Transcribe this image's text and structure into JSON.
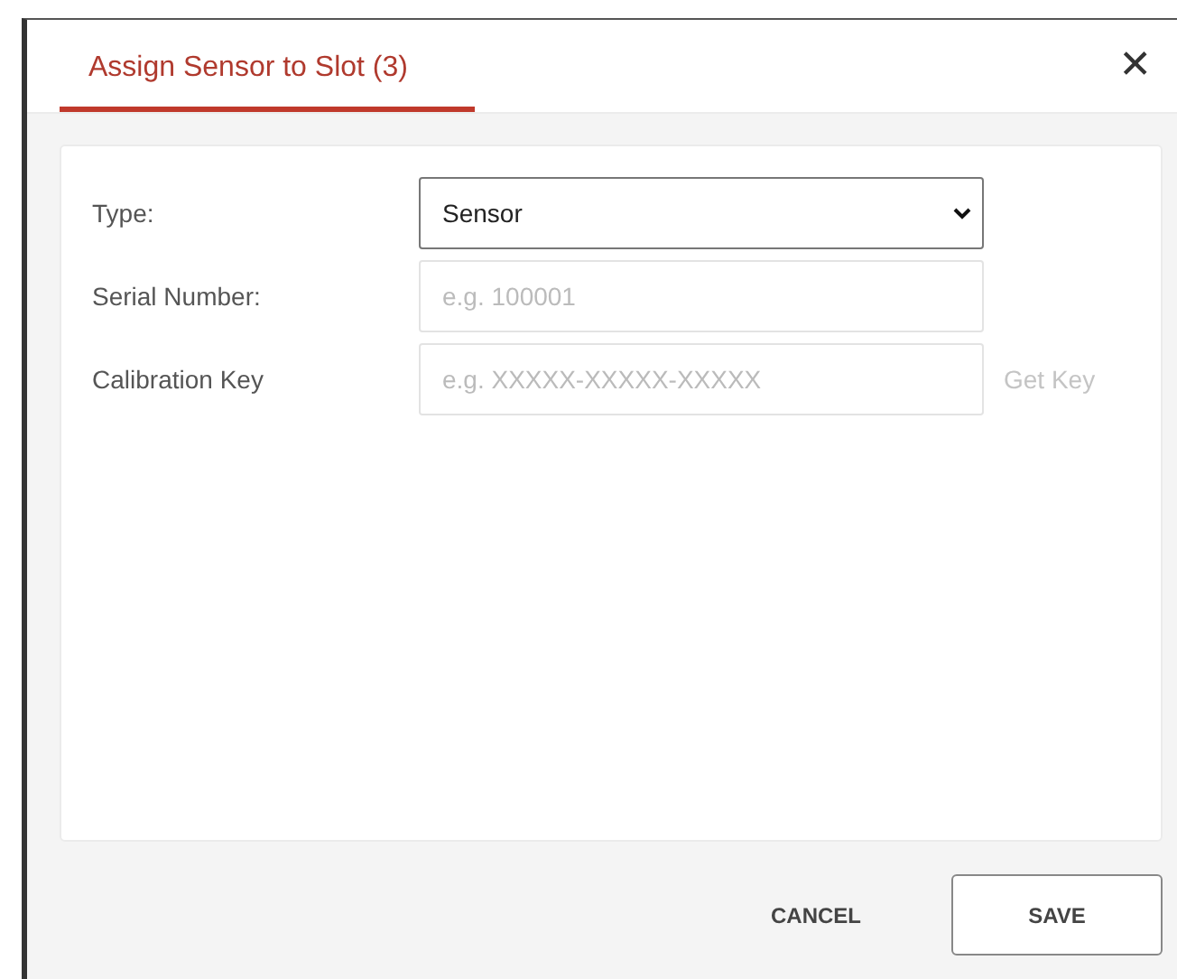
{
  "dialog": {
    "title": "Assign Sensor to Slot (3)",
    "close": "✕"
  },
  "fields": [
    {
      "kind": "select",
      "label": "Type:",
      "value": "Sensor"
    },
    {
      "kind": "text",
      "label": "Serial Number:",
      "placeholder": "e.g. 100001"
    },
    {
      "kind": "text",
      "label": "Calibration Key",
      "placeholder": "e.g. XXXXX-XXXXX-XXXXX",
      "action": {
        "label": "Get Key",
        "disabled": true
      }
    }
  ],
  "buttons": [
    {
      "label": "CANCEL",
      "kind": "flat"
    },
    {
      "label": "SAVE",
      "kind": "outlined"
    }
  ]
}
